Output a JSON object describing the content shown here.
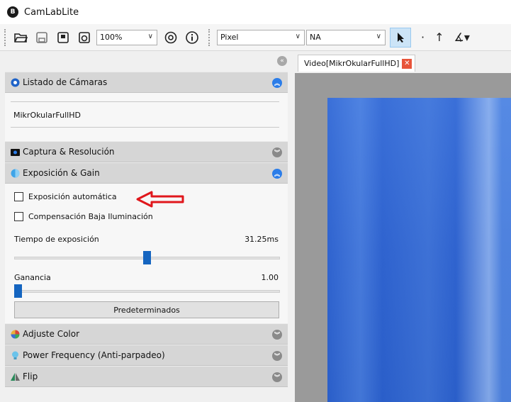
{
  "app": {
    "title": "CamLabLite",
    "logo_letter": "B"
  },
  "toolbar": {
    "zoom_value": "100%",
    "unit_value": "Pixel",
    "na_value": "NA",
    "icons": [
      "open-folder-icon",
      "save-icon",
      "save-video-icon",
      "capture-icon",
      "settings-icon",
      "info-icon",
      "pointer-icon",
      "dot-icon",
      "arrow-up-icon",
      "angle-icon"
    ]
  },
  "left_panel": {
    "camera_list": {
      "header": "Listado de Cámaras",
      "camera_name": "MikrOkularFullHD"
    },
    "capture": {
      "header": "Captura & Resolución"
    },
    "exposure": {
      "header": "Exposición & Gain",
      "auto_exposure_label": "Exposición automática",
      "auto_exposure_checked": false,
      "low_light_label": "Compensación Baja Iluminación",
      "low_light_checked": false,
      "exposure_time_label": "Tiempo de exposición",
      "exposure_time_value": "31.25ms",
      "exposure_slider_fraction": 0.5,
      "gain_label": "Ganancia",
      "gain_value": "1.00",
      "gain_slider_fraction": 0.0,
      "defaults_button": "Predeterminados"
    },
    "color": {
      "header": "Adjuste Color"
    },
    "power": {
      "header": "Power Frequency (Anti-parpadeo)"
    },
    "flip": {
      "header": "Flip"
    }
  },
  "video": {
    "tab_label": "Video[MikrOkularFullHD]"
  },
  "colors": {
    "accent": "#2b7de9",
    "slider_thumb": "#1565c0",
    "annotation_arrow": "#e0171c",
    "video_blue": "#2f63cf"
  }
}
